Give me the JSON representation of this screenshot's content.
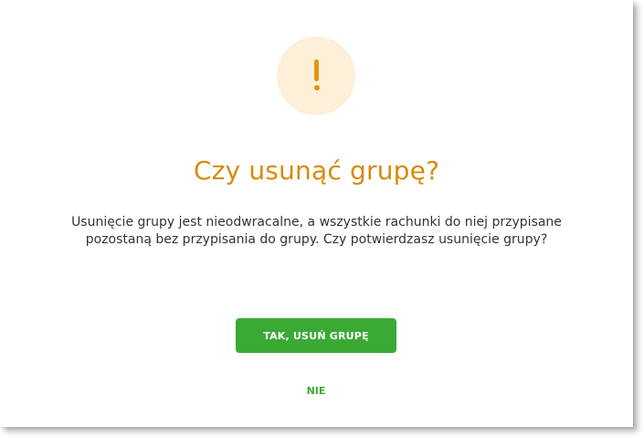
{
  "dialog": {
    "icon": "exclamation-warning-icon",
    "title": "Czy usunąć grupę?",
    "message": "Usunięcie grupy jest nieodwracalne, a wszystkie rachunki do niej przypisane pozostaną bez przypisania do grupy. Czy potwierdzasz usunięcie grupy?",
    "confirm_label": "TAK, USUŃ GRUPĘ",
    "cancel_label": "NIE"
  },
  "colors": {
    "accent": "#d88a0c",
    "icon_background": "#fdefd8",
    "primary_button": "#3aaa35",
    "text": "#333333"
  }
}
